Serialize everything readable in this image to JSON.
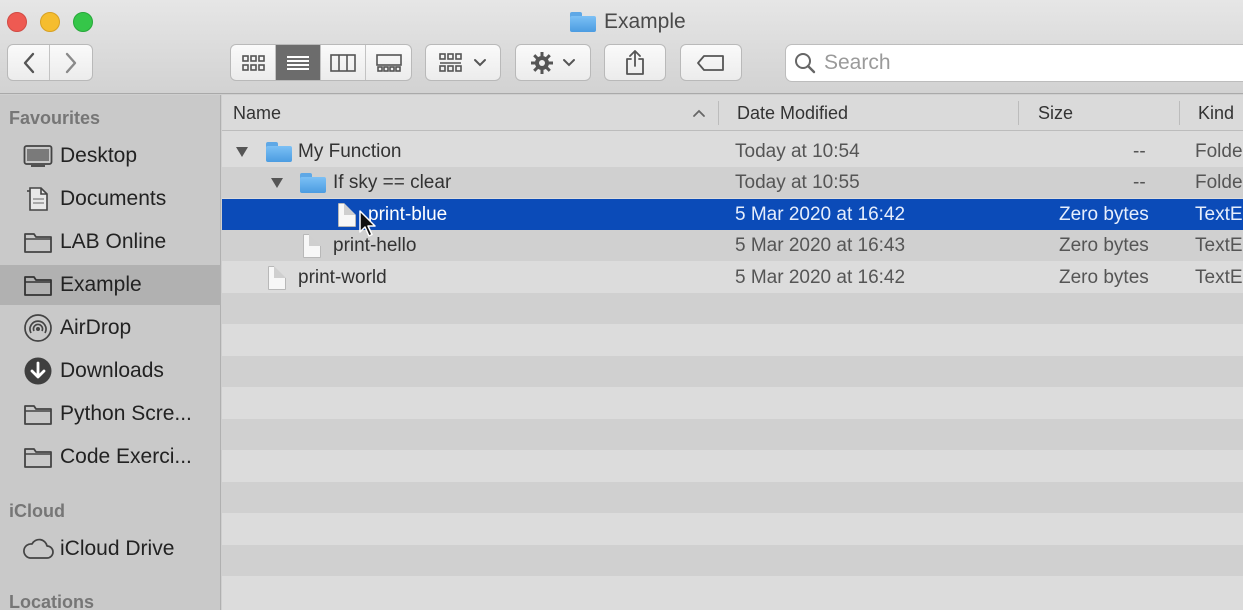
{
  "window": {
    "title": "Example"
  },
  "toolbar": {
    "back_icon": "chevron-left-icon",
    "forward_icon": "chevron-right-icon",
    "view_modes": [
      "icon-view",
      "list-view",
      "column-view",
      "gallery-view"
    ],
    "active_view": "list-view",
    "search_placeholder": "Search"
  },
  "sidebar": {
    "sections": [
      {
        "header": "Favourites",
        "items": [
          {
            "label": "Desktop",
            "icon": "desktop-icon"
          },
          {
            "label": "Documents",
            "icon": "documents-icon"
          },
          {
            "label": "LAB Online",
            "icon": "folder-icon"
          },
          {
            "label": "Example",
            "icon": "folder-icon",
            "selected": true
          },
          {
            "label": "AirDrop",
            "icon": "airdrop-icon"
          },
          {
            "label": "Downloads",
            "icon": "downloads-icon"
          },
          {
            "label": "Python Scre...",
            "icon": "folder-icon"
          },
          {
            "label": "Code Exerci...",
            "icon": "folder-icon"
          }
        ]
      },
      {
        "header": "iCloud",
        "items": [
          {
            "label": "iCloud Drive",
            "icon": "cloud-icon"
          }
        ]
      },
      {
        "header": "Locations",
        "items": []
      }
    ]
  },
  "list": {
    "columns": {
      "name": "Name",
      "date": "Date Modified",
      "size": "Size",
      "kind": "Kind"
    },
    "sort_column": "name",
    "rows": [
      {
        "name": "My Function",
        "type": "folder",
        "level": 0,
        "expanded": true,
        "date": "Today at 10:54",
        "size": "--",
        "kind": "Folde"
      },
      {
        "name": "If sky == clear",
        "type": "folder",
        "level": 1,
        "expanded": true,
        "date": "Today at 10:55",
        "size": "--",
        "kind": "Folde"
      },
      {
        "name": "print-blue",
        "type": "file",
        "level": 2,
        "selected": true,
        "date": "5 Mar 2020 at 16:42",
        "size": "Zero bytes",
        "kind": "TextE"
      },
      {
        "name": "print-hello",
        "type": "file",
        "level": 1,
        "date": "5 Mar 2020 at 16:43",
        "size": "Zero bytes",
        "kind": "TextE"
      },
      {
        "name": "print-world",
        "type": "file",
        "level": 0,
        "date": "5 Mar 2020 at 16:42",
        "size": "Zero bytes",
        "kind": "TextE"
      }
    ]
  },
  "colors": {
    "selection": "#0b4bb8",
    "folder": "#5fa8e6",
    "close": "#ee5a52",
    "minimize": "#f5bd2f",
    "zoom": "#35c649"
  }
}
